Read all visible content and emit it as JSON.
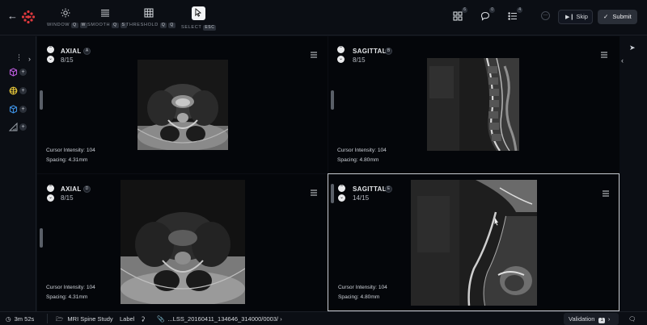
{
  "toolbar": {
    "tools": [
      {
        "label": "WINDOW",
        "keys": [
          "Q",
          "W"
        ],
        "icon": "sun-icon"
      },
      {
        "label": "SMOOTH",
        "keys": [
          "Q",
          "S"
        ],
        "icon": "smooth-icon"
      },
      {
        "label": "THRESHOLD",
        "keys": [
          "Q",
          "Q"
        ],
        "icon": "grid-icon"
      },
      {
        "label": "SELECT",
        "keys": [
          "ESC"
        ],
        "icon": "pointer-icon"
      }
    ],
    "badges": {
      "layers": "6",
      "comments": "0",
      "list": "4"
    },
    "skip_label": "Skip",
    "submit_label": "Submit"
  },
  "viewports": [
    {
      "title": "AXIAL",
      "letter": "A",
      "index": "8/15",
      "cursor_intensity": "Cursor Intensity: 104",
      "spacing": "Spacing: 4.31mm"
    },
    {
      "title": "SAGITTAL",
      "letter": "B",
      "index": "8/15",
      "cursor_intensity": "Cursor Intensity: 104",
      "spacing": "Spacing: 4.80mm"
    },
    {
      "title": "AXIAL",
      "letter": "D",
      "index": "8/15",
      "cursor_intensity": "Cursor Intensity: 104",
      "spacing": "Spacing: 4.31mm"
    },
    {
      "title": "SAGITTAL",
      "letter": "E",
      "index": "14/15",
      "cursor_intensity": "Cursor Intensity: 104",
      "spacing": "Spacing: 4.80mm"
    }
  ],
  "footer": {
    "timer": "3m 52s",
    "study": "MRI Spine Study",
    "label": "Label",
    "file": "...LSS_20160411_134646_314000/0003/",
    "validation_label": "Validation",
    "validation_count": "1"
  },
  "colors": {
    "background": "#0b0e14",
    "active_border": "#c9ccd1",
    "logo_red": "#e0393e",
    "layer_purple": "#b95ad9",
    "layer_yellow": "#e3c43a",
    "layer_blue": "#3d8fe0"
  }
}
